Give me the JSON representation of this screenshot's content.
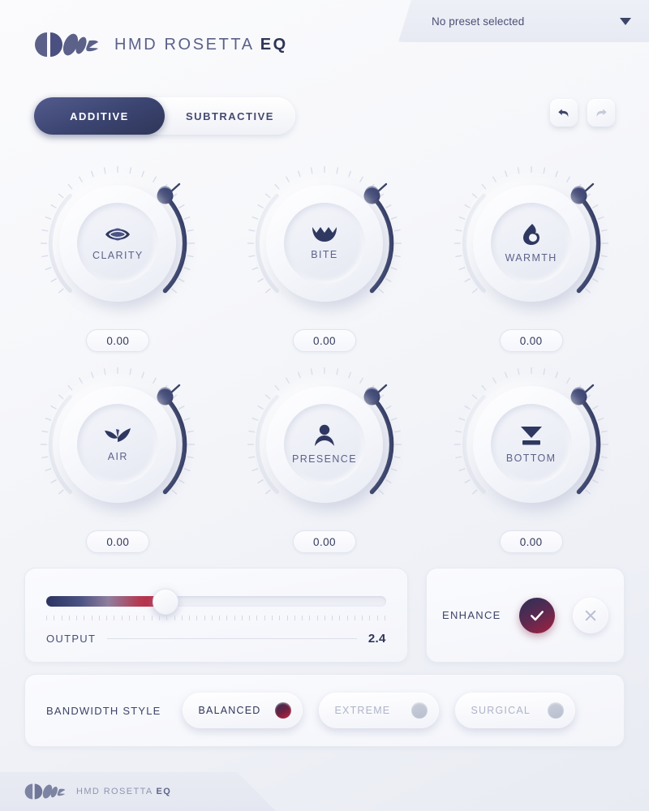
{
  "header": {
    "brand_name": "HMD ROSETTA ",
    "brand_suffix": "EQ",
    "preset_value": "No preset selected",
    "preset_caret_icon": "chevron-down-icon",
    "logo_icon": "rosetta-logo-mark"
  },
  "mode": {
    "additive_label": "ADDITIVE",
    "subtractive_label": "SUBTRACTIVE",
    "selected": "ADDITIVE"
  },
  "history": {
    "undo_icon": "undo-arrow-icon",
    "redo_icon": "redo-arrow-icon",
    "undo_enabled": "true",
    "redo_enabled": "false"
  },
  "knobs": [
    {
      "label": "CLARITY",
      "value": "0.00",
      "icon": "eye-icon"
    },
    {
      "label": "BITE",
      "value": "0.00",
      "icon": "teeth-icon"
    },
    {
      "label": "WARMTH",
      "value": "0.00",
      "icon": "flame-icon"
    },
    {
      "label": "AIR",
      "value": "0.00",
      "icon": "wing-icon"
    },
    {
      "label": "PRESENCE",
      "value": "0.00",
      "icon": "person-icon"
    },
    {
      "label": "BOTTOM",
      "value": "0.00",
      "icon": "arrow-down-to-bar-icon"
    }
  ],
  "output": {
    "label": "OUTPUT",
    "value": "2.4",
    "slider_percent": 35
  },
  "enhance": {
    "label": "ENHANCE",
    "on_icon": "check-icon",
    "off_icon": "close-icon",
    "state": "on"
  },
  "bandwidth": {
    "label": "BANDWIDTH STYLE",
    "options": [
      {
        "label": "BALANCED",
        "selected": true
      },
      {
        "label": "EXTREME",
        "selected": false
      },
      {
        "label": "SURGICAL",
        "selected": false
      }
    ]
  },
  "footer": {
    "brand_name": "HMD ROSETTA ",
    "brand_suffix": "EQ",
    "logo_icon": "rosetta-logo-mark"
  },
  "colors": {
    "navy": "#2f3659",
    "crimson": "#c1233f",
    "muted": "#aeb3c9",
    "background": "#f2f3f8"
  }
}
